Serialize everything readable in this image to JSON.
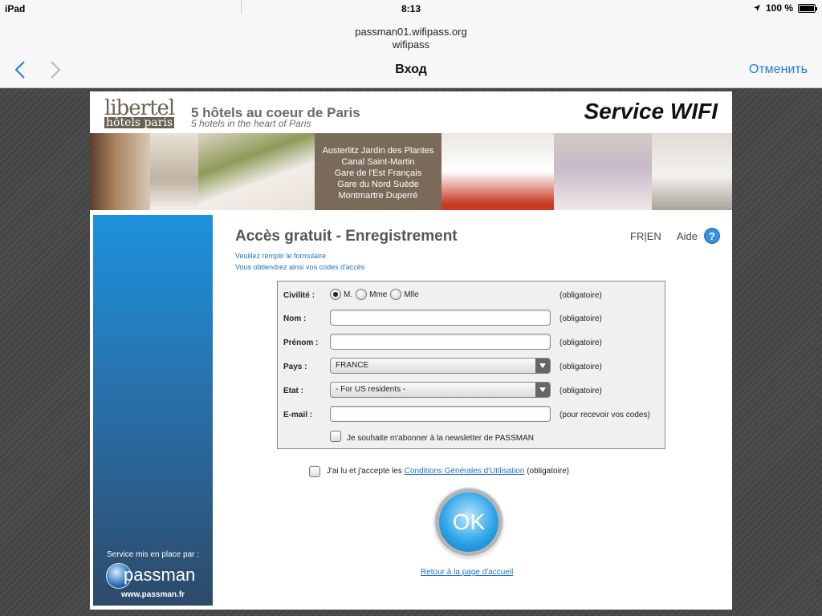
{
  "status_bar": {
    "device": "iPad",
    "time": "8:13",
    "battery": "100 %",
    "battery_level": 1.0
  },
  "browser": {
    "domain_line1": "passman01.wifipass.org",
    "domain_line2": "wifipass",
    "title": "Вход",
    "cancel_label": "Отменить"
  },
  "header": {
    "logo_line1": "libertel",
    "logo_line2": "hôtels paris",
    "tagline_fr": "5 hôtels au coeur de Paris",
    "tagline_en": "5 hotels in the heart of Paris",
    "service_title": "Service WIFI"
  },
  "hotels": [
    "Austerlitz Jardin des Plantes",
    "Canal Saint-Martin",
    "Gare de l'Est Français",
    "Gare du Nord Suède",
    "Montmartre Duperré"
  ],
  "sidebar": {
    "note": "Service mis en place par :",
    "brand": "passman",
    "url": "www.passman.fr"
  },
  "content": {
    "title": "Accès gratuit - Enregistrement",
    "lang_fr": "FR",
    "lang_sep": "|",
    "lang_en": "EN",
    "help_label": "Aide",
    "help_icon_glyph": "?",
    "intro_line1": "Veuillez remplir le formulaire",
    "intro_line2": "Vous obtiendrez ainsi vos codes d'accès"
  },
  "form": {
    "civilite": {
      "label": "Civilité :",
      "options": [
        "M.",
        "Mme",
        "Mlle"
      ],
      "selected": "M.",
      "req": "(obligatoire)"
    },
    "nom": {
      "label": "Nom :",
      "value": "",
      "req": "(obligatoire)"
    },
    "prenom": {
      "label": "Prénom :",
      "value": "",
      "req": "(obligatoire)"
    },
    "pays": {
      "label": "Pays :",
      "value": "FRANCE",
      "req": "(obligatoire)"
    },
    "etat": {
      "label": "Etat :",
      "value": "- For US residents -",
      "req": "(obligatoire)"
    },
    "email": {
      "label": "E-mail :",
      "value": "",
      "req": "(pour recevoir vos codes)"
    },
    "newsletter": {
      "label": "Je souhaite m'abonner à la newsletter de PASSMAN",
      "checked": false
    }
  },
  "cgu": {
    "prefix": "J'ai lu et j'accepte les",
    "link": "Conditions Générales d'Utilisation",
    "suffix": "(obligatoire)",
    "checked": false
  },
  "ok_label": "OK",
  "back_link": "Retour à la page d'accueil",
  "colors": {
    "accent": "#1a7ee6",
    "link": "#2373c8",
    "sidebar_top": "#1c92dc",
    "sidebar_bottom": "#2d4a68"
  }
}
